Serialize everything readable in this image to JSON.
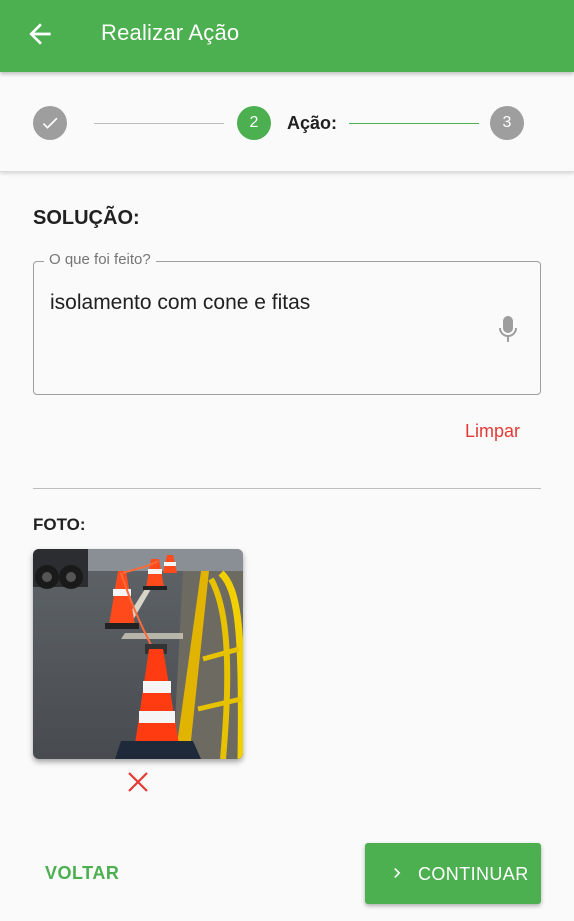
{
  "appbar": {
    "title": "Realizar Ação",
    "back_icon": "arrow-left-icon"
  },
  "stepper": {
    "steps": [
      {
        "state": "completed",
        "icon": "check-icon"
      },
      {
        "state": "active",
        "number": "2",
        "label": "Ação:"
      },
      {
        "state": "pending",
        "number": "3"
      }
    ]
  },
  "solution": {
    "title": "SOLUÇÃO:",
    "field_label": "O que foi feito?",
    "value": "isolamento com cone e fitas",
    "mic_icon": "microphone-icon",
    "clear_label": "Limpar"
  },
  "photo": {
    "label": "FOTO:",
    "remove_icon": "close-icon"
  },
  "footer": {
    "back_label": "VOLTAR",
    "continue_label": "CONTINUAR",
    "continue_icon": "chevron-right-icon"
  },
  "colors": {
    "primary": "#4caf50",
    "danger": "#e53935",
    "inactive_step": "#9e9e9e"
  }
}
